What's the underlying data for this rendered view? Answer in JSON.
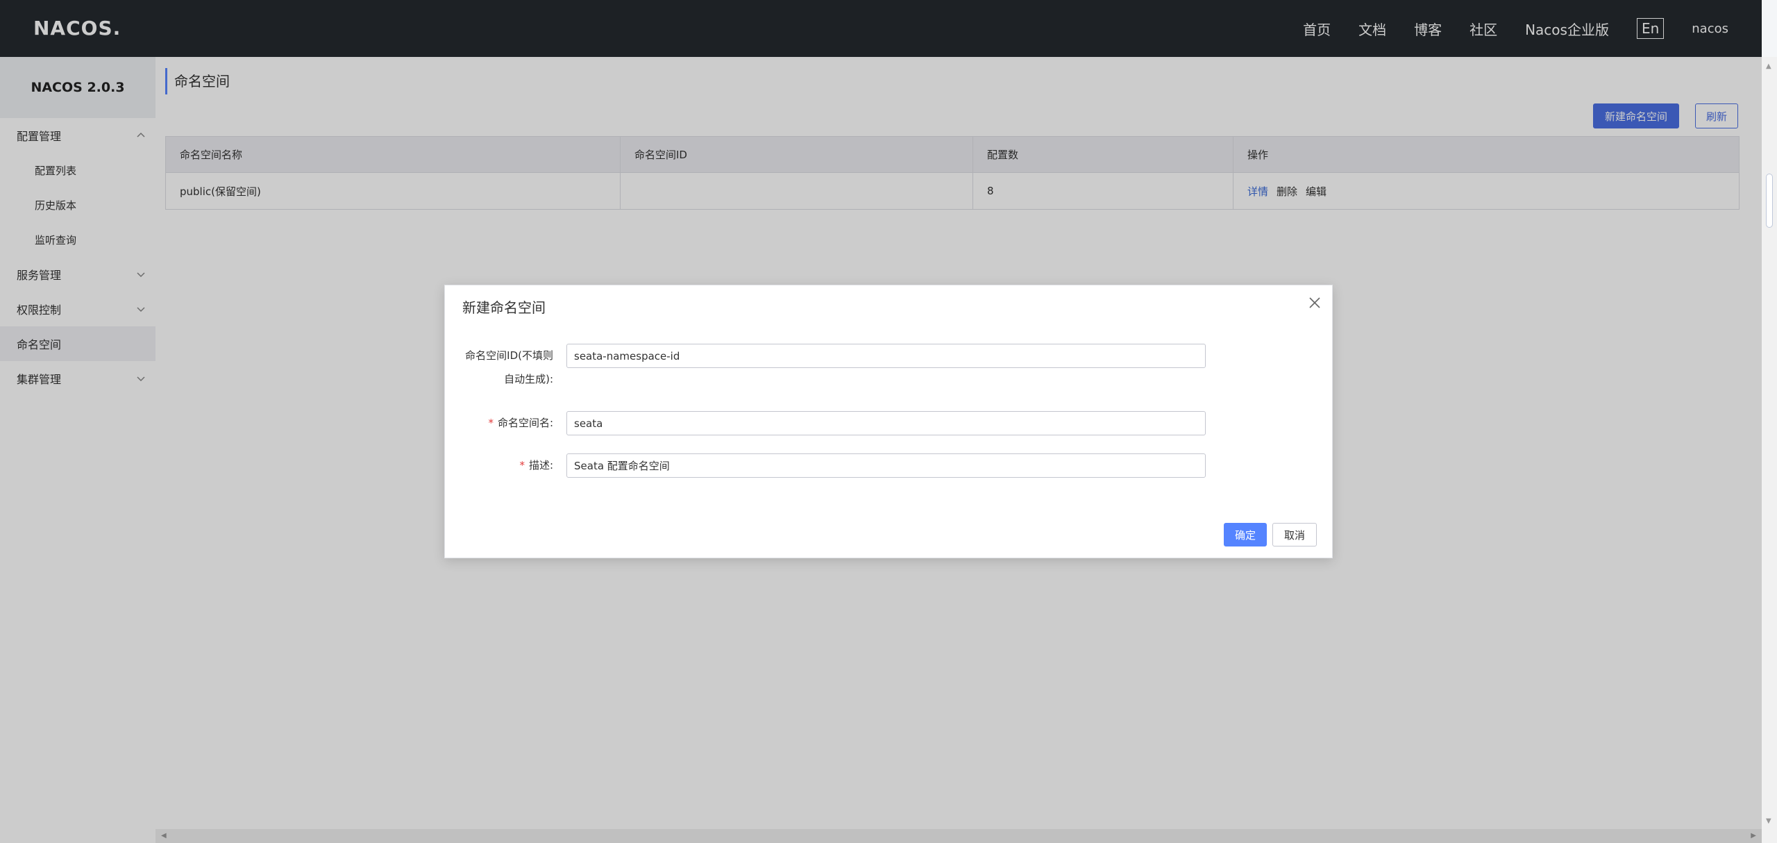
{
  "header": {
    "logo": "NACOS.",
    "nav": [
      "首页",
      "文档",
      "博客",
      "社区",
      "Nacos企业版"
    ],
    "lang": "En",
    "user": "nacos"
  },
  "sidebar": {
    "title": "NACOS 2.0.3",
    "items": [
      {
        "label": "配置管理"
      },
      {
        "label": "配置列表"
      },
      {
        "label": "历史版本"
      },
      {
        "label": "监听查询"
      },
      {
        "label": "服务管理"
      },
      {
        "label": "权限控制"
      },
      {
        "label": "命名空间"
      },
      {
        "label": "集群管理"
      }
    ]
  },
  "main": {
    "title": "命名空间",
    "new_button": "新建命名空间",
    "refresh_button": "刷新",
    "table": {
      "headers": [
        "命名空间名称",
        "命名空间ID",
        "配置数",
        "操作"
      ],
      "rows": [
        {
          "name": "public(保留空间)",
          "id": "",
          "count": "8",
          "ops": [
            "详情",
            "删除",
            "编辑"
          ]
        }
      ]
    }
  },
  "dialog": {
    "title": "新建命名空间",
    "fields": [
      {
        "label_line1": "命名空间ID(不填则",
        "label_line2": "自动生成):",
        "value": "seata-namespace-id"
      },
      {
        "label": "命名空间名:",
        "required": "*",
        "value": "seata"
      },
      {
        "label": "描述:",
        "required": "*",
        "value": "Seata 配置命名空间"
      }
    ],
    "ok": "确定",
    "cancel": "取消"
  },
  "colors": {
    "header_bg": "#252a2f",
    "primary": "#5584ff",
    "link": "#3b6bd6",
    "required": "#e23b3b"
  }
}
